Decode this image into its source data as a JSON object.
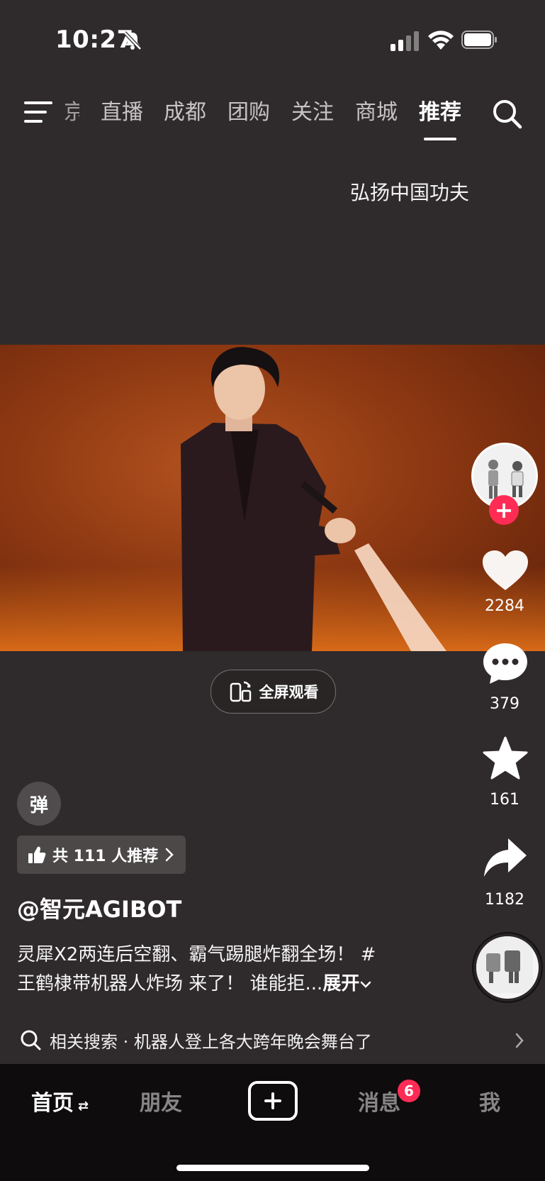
{
  "status_bar": {
    "time": "10:27"
  },
  "top_nav": {
    "partial_tab": "京",
    "tabs": [
      "直播",
      "成都",
      "团购",
      "关注",
      "商城",
      "推荐"
    ],
    "active_tab": "推荐"
  },
  "video": {
    "top_caption": "弘扬中国功夫",
    "fullscreen_label": "全屏观看"
  },
  "right_rail": {
    "likes": "2284",
    "comments": "379",
    "favorites": "161",
    "shares": "1182"
  },
  "info": {
    "danmu_label": "弹",
    "recommend_label": "共 111 人推荐",
    "author": "@智元AGIBOT",
    "description_line1": "灵犀X2两连后空翻、霸气踢腿炸翻全场！ #",
    "description_line2": "王鹤棣带机器人炸场 来了！ 谁能拒...",
    "expand_label": "展开"
  },
  "related_search": {
    "label": "相关搜索 · 机器人登上各大跨年晚会舞台了"
  },
  "tab_bar": {
    "home": "首页",
    "friends": "朋友",
    "messages": "消息",
    "messages_badge": "6",
    "me": "我"
  },
  "colors": {
    "accent": "#fe2c55",
    "background": "#2f2a2b",
    "tabbar": "#0f0c0d"
  }
}
